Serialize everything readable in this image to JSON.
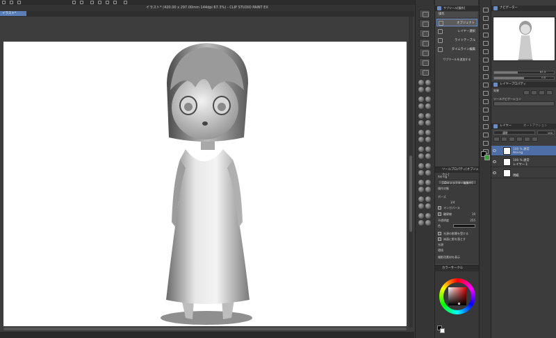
{
  "window": {
    "title": "イラスト* (420.00 x 297.00mm 144dpi 67.3%) - CLIP STUDIO PAINT EX",
    "document_tab": "イラスト*"
  },
  "sub_tool": {
    "header": "サブツール[操作]",
    "group_label": "操作",
    "items": [
      {
        "label": "オブジェクト",
        "icon": "object-icon",
        "active": true
      },
      {
        "label": "レイヤー選択",
        "icon": "layer-select-icon",
        "active": false
      },
      {
        "label": "ライトテーブル",
        "icon": "lighttable-icon",
        "active": false
      },
      {
        "label": "タイムライン編集",
        "icon": "timeline-icon",
        "active": false
      }
    ],
    "add_label": "サブツールを追加する"
  },
  "tool_property": {
    "header": "ツールプロパティ[オブジェクト]",
    "object_name": "Ani-rig",
    "character_button": "[3Dキャラクター編集中]",
    "operation_target": "操作対象",
    "pose_label": "ポーズ",
    "pose_value": "1/4",
    "mannequin_label": "マンガパース",
    "outline_label": "輪郭線",
    "outline_width": "10",
    "opacity_label": "不透明度",
    "opacity_value": "255",
    "color_label": "色",
    "light_label": "光源の影響を受ける",
    "shadow_label": "床面に影を落とす",
    "light_source_label": "光源",
    "env_label": "環境",
    "expand_label": "撮影用素材を表示"
  },
  "color_panel": {
    "header": "カラーサークル",
    "main_color": "#000000",
    "sub_color": "#ffffff",
    "wheel_hue": "#e00000"
  },
  "navigator": {
    "header": "ナビゲーター",
    "zoom": "67.3",
    "rotation": "0.0"
  },
  "layer_property": {
    "header": "レイヤープロパティ",
    "effect_label": "効果",
    "tool_nav_label": "ツールナビゲーション"
  },
  "layers": {
    "header": "レイヤー",
    "header_tab2": "オートアクション",
    "blend_mode": "通常",
    "opacity": "100",
    "items": [
      {
        "opacity_mode": "100 % 通常",
        "name": "Ani-rig",
        "selected": true
      },
      {
        "opacity_mode": "100 % 通常",
        "name": "レイヤー 1",
        "selected": false
      },
      {
        "opacity_mode": "",
        "name": "用紙",
        "selected": false
      }
    ]
  },
  "colors": {
    "accent": "#6a8cc4",
    "selection": "#4e6ea8",
    "canvas": "#ffffff",
    "ui_bg": "#3a3a3a"
  }
}
